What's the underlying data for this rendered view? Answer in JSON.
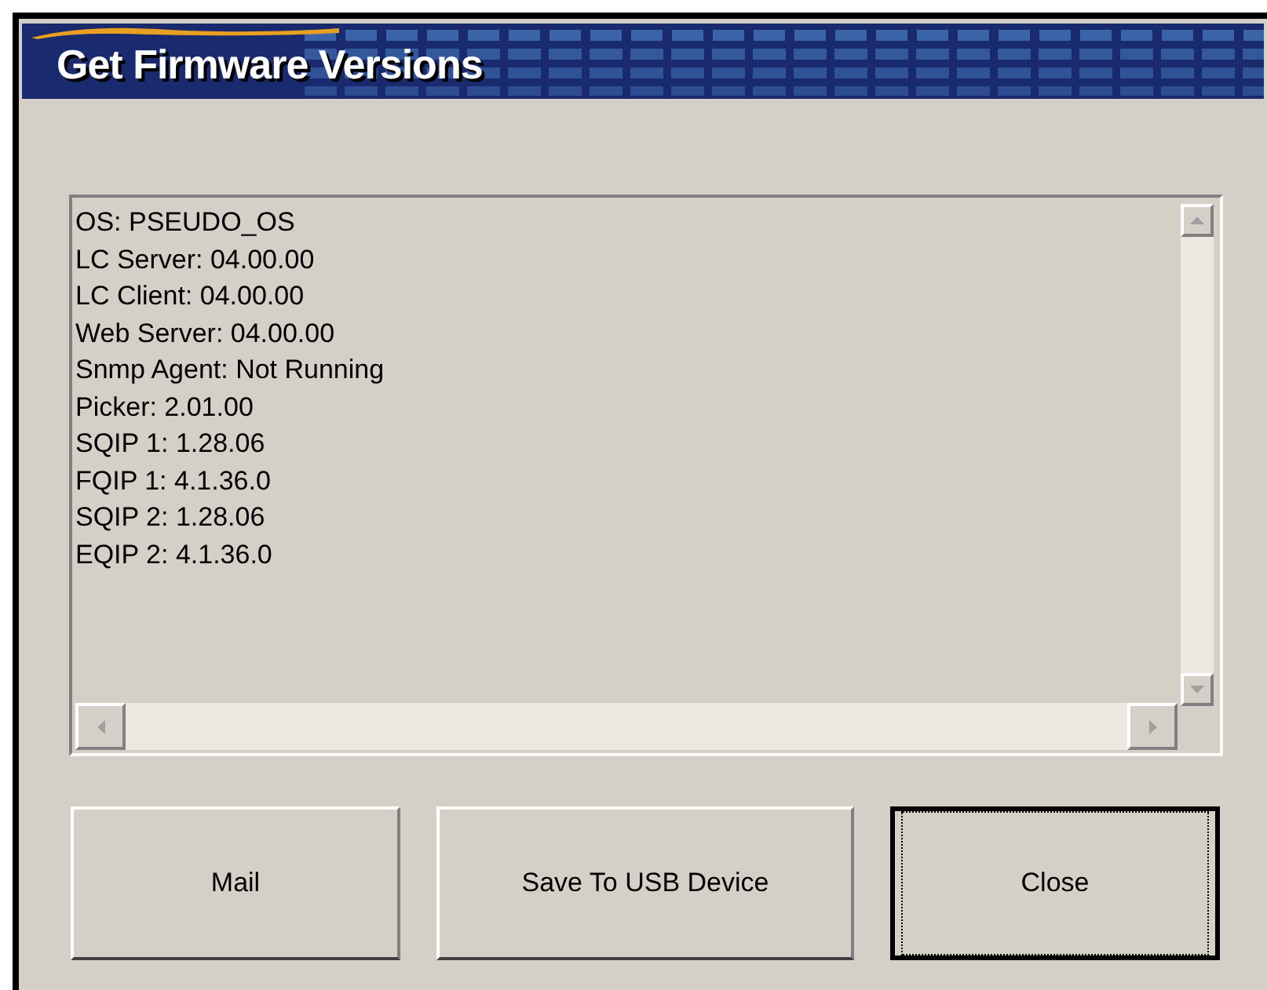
{
  "window": {
    "title": "Get Firmware Versions"
  },
  "versions": [
    "OS: PSEUDO_OS",
    "LC Server: 04.00.00",
    "LC Client: 04.00.00",
    "Web Server: 04.00.00",
    "Snmp Agent: Not Running",
    "Picker: 2.01.00",
    "SQIP 1: 1.28.06",
    "FQIP 1: 4.1.36.0",
    "SQIP 2: 1.28.06",
    "EQIP 2: 4.1.36.0"
  ],
  "buttons": [
    {
      "label": "Mail",
      "focused": false
    },
    {
      "label": "Save To USB Device",
      "focused": false
    },
    {
      "label": "Close",
      "focused": true
    }
  ]
}
